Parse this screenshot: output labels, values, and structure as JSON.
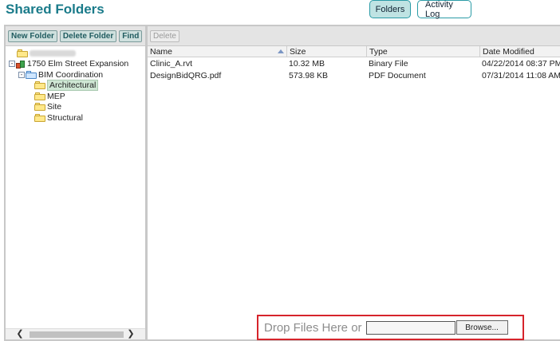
{
  "header": {
    "title": "Shared Folders",
    "tabs": [
      {
        "label": "Folders",
        "active": true
      },
      {
        "label": "Activity Log",
        "active": false
      }
    ]
  },
  "left_toolbar": {
    "new_folder": "New Folder",
    "delete_folder": "Delete Folder",
    "find": "Find"
  },
  "tree": {
    "root": {
      "label": "",
      "blurred": true
    },
    "project": {
      "label": "1750 Elm Street Expansion",
      "expander": "-"
    },
    "group": {
      "label": "BIM Coordination",
      "expander": "-"
    },
    "folders": [
      {
        "label": "Architectural",
        "selected": true
      },
      {
        "label": "MEP",
        "selected": false
      },
      {
        "label": "Site",
        "selected": false
      },
      {
        "label": "Structural",
        "selected": false
      }
    ]
  },
  "right_toolbar": {
    "delete": "Delete"
  },
  "grid": {
    "columns": {
      "name": "Name",
      "size": "Size",
      "type": "Type",
      "date": "Date Modified"
    },
    "sort": {
      "column": "Name",
      "direction": "ascending"
    },
    "rows": [
      {
        "name": "Clinic_A.rvt",
        "size": "10.32 MB",
        "type": "Binary File",
        "date": "04/22/2014 08:37 PM"
      },
      {
        "name": "DesignBidQRG.pdf",
        "size": "573.98 KB",
        "type": "PDF Document",
        "date": "07/31/2014 11:08 AM"
      }
    ]
  },
  "upload": {
    "drop_text": "Drop Files Here or",
    "file_value": "",
    "browse_label": "Browse..."
  },
  "colors": {
    "title": "#1a7b8a",
    "tab_border": "#2a9ba6",
    "active_tab": "#bfe3e3",
    "highlight_border": "#d6242b",
    "selected_folder": "#cfe7d4"
  }
}
